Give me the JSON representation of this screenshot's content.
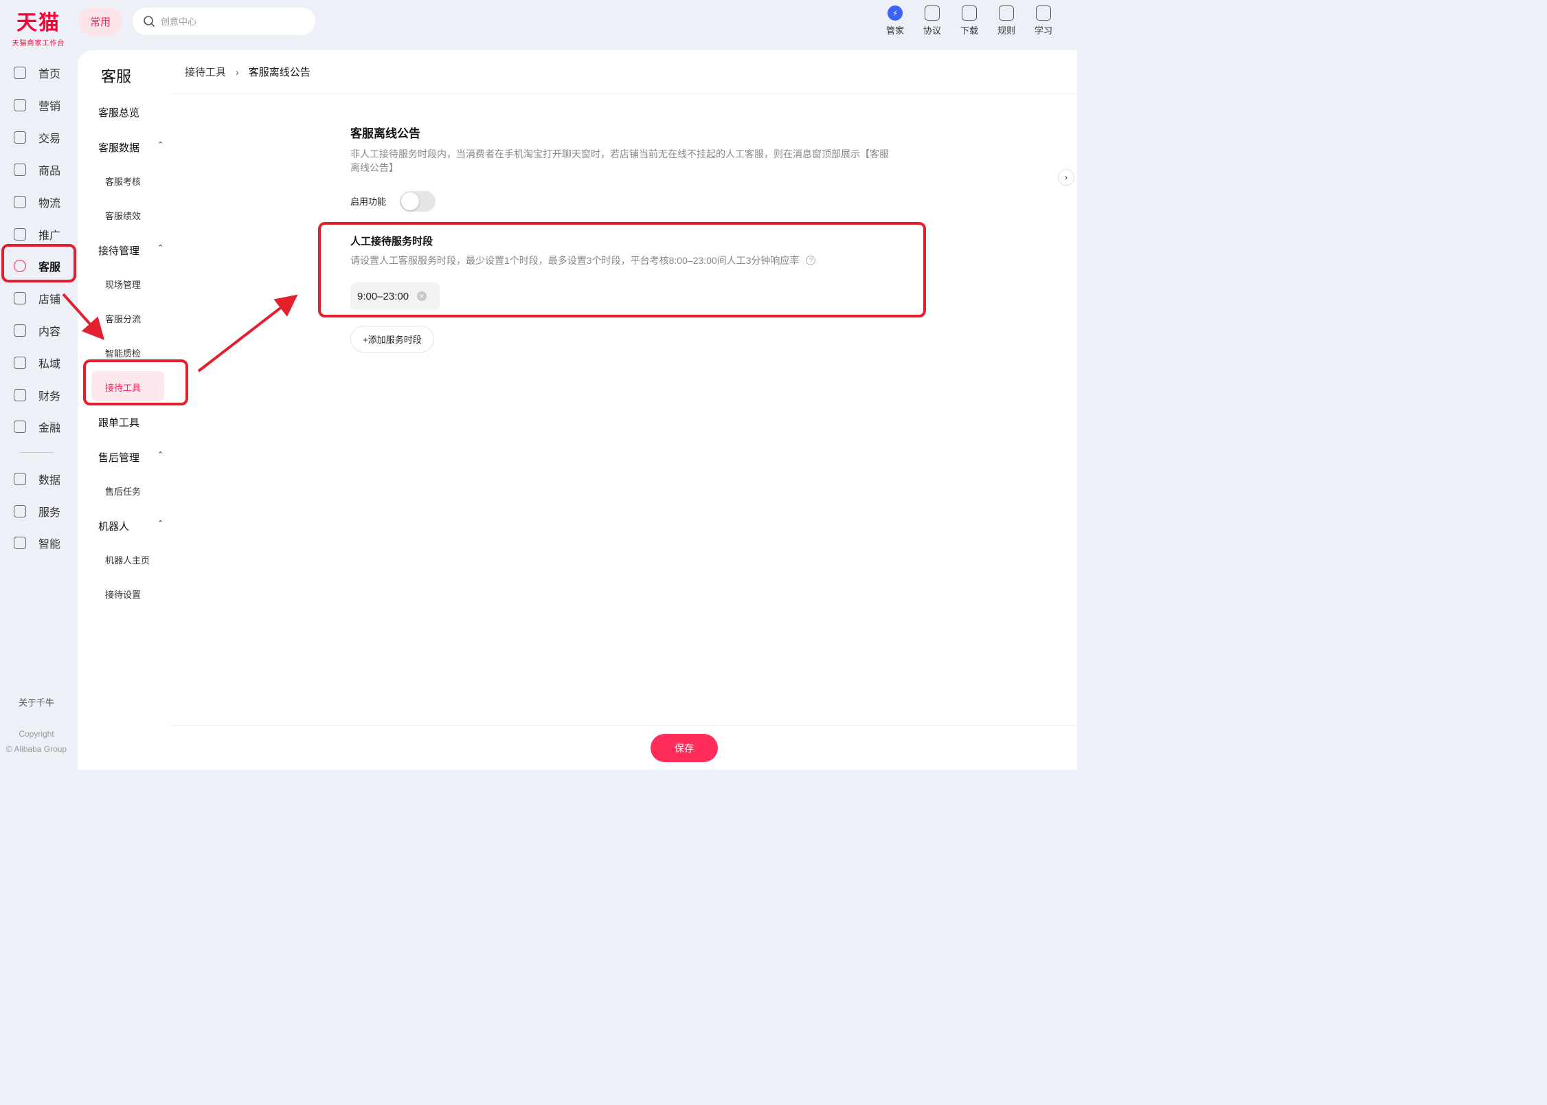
{
  "logo": {
    "main": "天猫",
    "sub": "天猫商家工作台"
  },
  "top": {
    "common_label": "常用",
    "search_placeholder": "创意中心",
    "tools": [
      {
        "label": "管家",
        "icon": "bolt-icon"
      },
      {
        "label": "协议",
        "icon": "document-icon"
      },
      {
        "label": "下载",
        "icon": "devices-icon"
      },
      {
        "label": "规则",
        "icon": "book-icon"
      },
      {
        "label": "学习",
        "icon": "chat-icon"
      }
    ]
  },
  "leftnav": {
    "items": [
      {
        "label": "首页",
        "icon": "home-icon"
      },
      {
        "label": "营销",
        "icon": "megaphone-icon"
      },
      {
        "label": "交易",
        "icon": "receipt-icon"
      },
      {
        "label": "商品",
        "icon": "bag-icon"
      },
      {
        "label": "物流",
        "icon": "truck-icon"
      },
      {
        "label": "推广",
        "icon": "bulb-icon"
      },
      {
        "label": "客服",
        "icon": "headset-icon"
      },
      {
        "label": "店铺",
        "icon": "store-icon"
      },
      {
        "label": "内容",
        "icon": "hash-icon"
      },
      {
        "label": "私域",
        "icon": "users-icon"
      },
      {
        "label": "财务",
        "icon": "yen-icon"
      },
      {
        "label": "金融",
        "icon": "diamond-icon"
      },
      {
        "label": "数据",
        "icon": "chart-icon"
      },
      {
        "label": "服务",
        "icon": "grid-icon"
      },
      {
        "label": "智能",
        "icon": "lightning-icon"
      }
    ],
    "about": "关于千牛",
    "copyright_line1": "Copyright",
    "copyright_line2": "© Alibaba Group"
  },
  "subnav": {
    "title": "客服",
    "overview": "客服总览",
    "data_group": "客服数据",
    "data_children": [
      "客服考核",
      "客服绩效"
    ],
    "reception_group": "接待管理",
    "reception_children": [
      "现场管理",
      "客服分流",
      "智能质检",
      "接待工具"
    ],
    "follow": "跟单工具",
    "aftersale_group": "售后管理",
    "aftersale_children": [
      "售后任务"
    ],
    "robot_group": "机器人",
    "robot_children": [
      "机器人主页",
      "接待设置"
    ]
  },
  "breadcrumb": {
    "parent": "接待工具",
    "sep": "›",
    "current": "客服离线公告"
  },
  "main": {
    "title": "客服离线公告",
    "desc": "非人工接待服务时段内，当消费者在手机淘宝打开聊天窗时，若店铺当前无在线不挂起的人工客服，则在消息窗顶部展示【客服离线公告】",
    "toggle_label": "启用功能",
    "toggle_on": false,
    "hours_title": "人工接待服务时段",
    "hours_desc": "请设置人工客服服务时段，最少设置1个时段，最多设置3个时段，平台考核8:00–23:00间人工3分钟响应率",
    "time_range": "9:00–23:00",
    "add_label": "+添加服务时段",
    "save_label": "保存"
  },
  "colors": {
    "accent": "#ff2d5a",
    "annotation": "#e4202e",
    "brand": "#ff0036"
  }
}
